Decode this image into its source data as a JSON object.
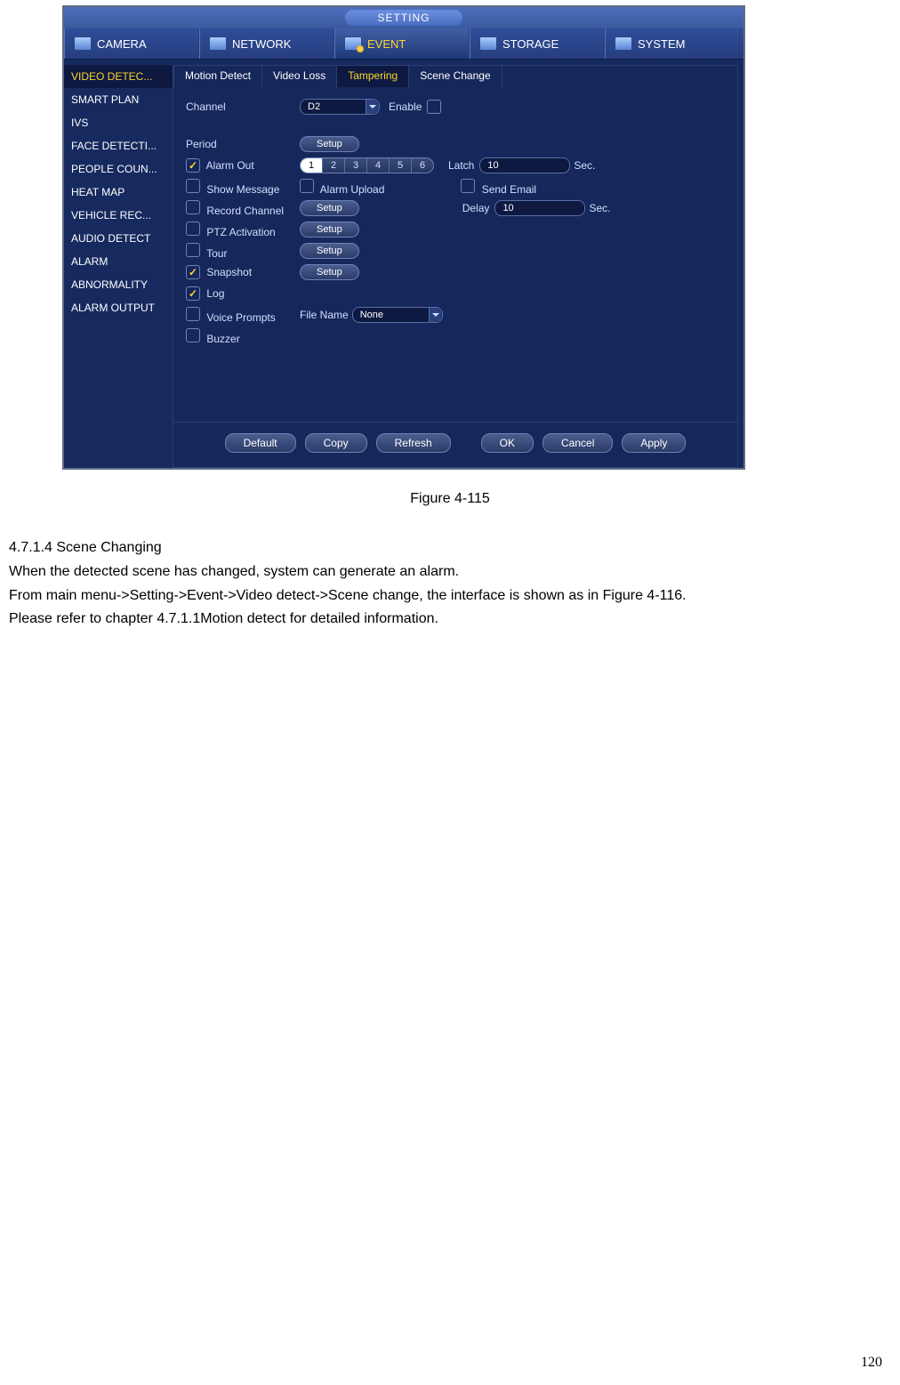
{
  "window": {
    "title": "SETTING",
    "maintabs": [
      "CAMERA",
      "NETWORK",
      "EVENT",
      "STORAGE",
      "SYSTEM"
    ],
    "active_maintab": "EVENT"
  },
  "sidebar": {
    "items": [
      "VIDEO DETEC...",
      "SMART PLAN",
      "IVS",
      "FACE DETECTI...",
      "PEOPLE COUN...",
      "HEAT MAP",
      "VEHICLE REC...",
      "AUDIO DETECT",
      "ALARM",
      "ABNORMALITY",
      "ALARM OUTPUT"
    ],
    "selected": "VIDEO DETEC..."
  },
  "subtabs": {
    "items": [
      "Motion Detect",
      "Video Loss",
      "Tampering",
      "Scene Change"
    ],
    "active": "Tampering"
  },
  "form": {
    "channel_label": "Channel",
    "channel_value": "D2",
    "enable_label": "Enable",
    "enable_checked": false,
    "period_label": "Period",
    "setup_label": "Setup",
    "alarm_out": {
      "label": "Alarm Out",
      "checked": true,
      "outputs": [
        "1",
        "2",
        "3",
        "4",
        "5",
        "6"
      ],
      "selected": "1"
    },
    "latch_label": "Latch",
    "latch_value": "10",
    "sec_label": "Sec.",
    "show_message": {
      "label": "Show Message",
      "checked": false
    },
    "alarm_upload": {
      "label": "Alarm Upload",
      "checked": false
    },
    "send_email": {
      "label": "Send Email",
      "checked": false
    },
    "record_channel": {
      "label": "Record Channel",
      "checked": false
    },
    "delay_label": "Delay",
    "delay_value": "10",
    "ptz": {
      "label": "PTZ Activation",
      "checked": false
    },
    "tour": {
      "label": "Tour",
      "checked": false
    },
    "snapshot": {
      "label": "Snapshot",
      "checked": true
    },
    "log": {
      "label": "Log",
      "checked": true
    },
    "voice": {
      "label": "Voice Prompts",
      "checked": false
    },
    "file_name_label": "File Name",
    "file_name_value": "None",
    "buzzer": {
      "label": "Buzzer",
      "checked": false
    }
  },
  "footer": {
    "buttons": [
      "Default",
      "Copy",
      "Refresh",
      "OK",
      "Cancel",
      "Apply"
    ]
  },
  "caption": "Figure 4-115",
  "doc": {
    "heading": "4.7.1.4 Scene Changing",
    "p1": "When the detected scene has changed, system can generate an alarm.",
    "p2": "From main menu->Setting->Event->Video detect->Scene change, the interface is shown as in Figure 4-116.",
    "p3": "Please refer to chapter 4.7.1.1Motion detect for detailed information."
  },
  "page_number": "120"
}
